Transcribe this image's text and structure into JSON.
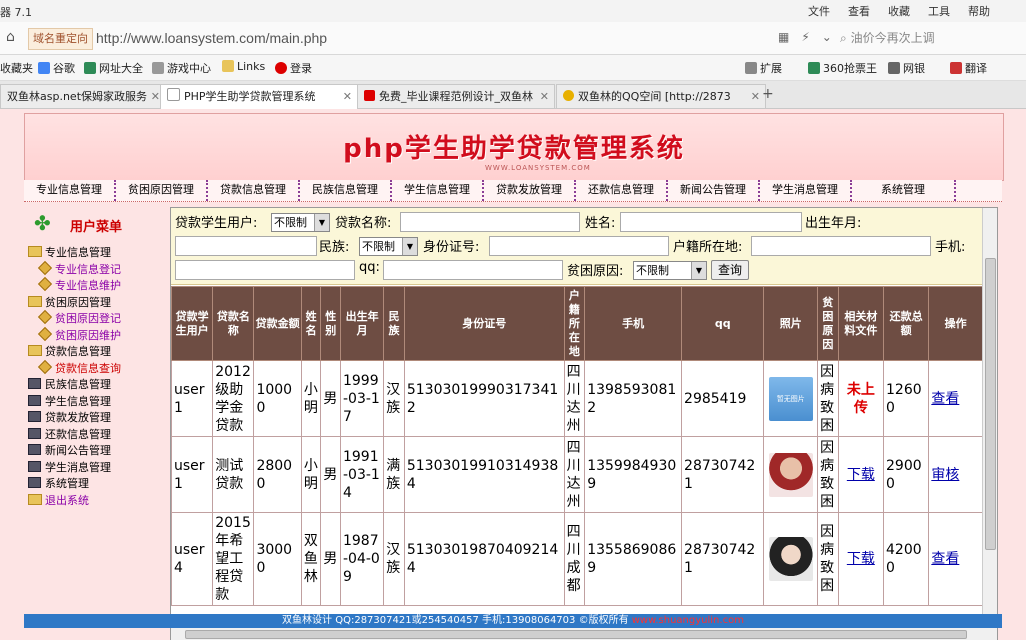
{
  "browser": {
    "app_title": "器 7.1",
    "menus": [
      "文件",
      "查看",
      "收藏",
      "工具",
      "帮助"
    ],
    "redirect_label": "域名重定向",
    "url": "http://www.loansystem.com/main.php",
    "search_placeholder": "油价今再次上调",
    "favorites": [
      {
        "label": "收藏夹",
        "color": "#f2b400"
      },
      {
        "label": "谷歌",
        "color": "#4285f4"
      },
      {
        "label": "网址大全",
        "color": "#2e8b57"
      },
      {
        "label": "游戏中心",
        "color": "#999"
      },
      {
        "label": "Links",
        "color": "#e8c45a"
      },
      {
        "label": "登录",
        "color": "#d00"
      },
      {
        "label": "扩展",
        "color": "#888"
      },
      {
        "label": "360抢票王",
        "color": "#2e8b57"
      },
      {
        "label": "网银",
        "color": "#666"
      },
      {
        "label": "翻译",
        "color": "#c33"
      }
    ],
    "tabs": [
      {
        "label": "双鱼林asp.net保姆家政服务",
        "color": "#2060c0",
        "active": false
      },
      {
        "label": "PHP学生助学贷款管理系统",
        "color": "#dddddd",
        "active": true
      },
      {
        "label": "免费_毕业课程范例设计_双鱼林",
        "color": "#d00",
        "active": false
      },
      {
        "label": "双鱼林的QQ空间 [http://2873",
        "color": "#e8b000",
        "active": false
      }
    ]
  },
  "banner": {
    "title": "php学生助学贷款管理系统",
    "subtitle": "WWW.LOANSYSTEM.COM"
  },
  "nav": [
    "专业信息管理",
    "贫困原因管理",
    "贷款信息管理",
    "民族信息管理",
    "学生信息管理",
    "贷款发放管理",
    "还款信息管理",
    "新闻公告管理",
    "学生消息管理",
    "系统管理"
  ],
  "sidebar": {
    "title": "用户菜单",
    "groups": [
      {
        "label": "专业信息管理",
        "type": "folder",
        "children": [
          {
            "label": "专业信息登记",
            "current": false
          },
          {
            "label": "专业信息维护",
            "current": false
          }
        ]
      },
      {
        "label": "贫困原因管理",
        "type": "folder",
        "children": [
          {
            "label": "贫困原因登记",
            "current": false
          },
          {
            "label": "贫困原因维护",
            "current": false
          }
        ]
      },
      {
        "label": "贷款信息管理",
        "type": "folder",
        "children": [
          {
            "label": "贷款信息查询",
            "current": true
          }
        ]
      },
      {
        "label": "民族信息管理",
        "type": "stack",
        "children": []
      },
      {
        "label": "学生信息管理",
        "type": "stack",
        "children": []
      },
      {
        "label": "贷款发放管理",
        "type": "stack",
        "children": []
      },
      {
        "label": "还款信息管理",
        "type": "stack",
        "children": []
      },
      {
        "label": "新闻公告管理",
        "type": "stack",
        "children": []
      },
      {
        "label": "学生消息管理",
        "type": "stack",
        "children": []
      },
      {
        "label": "系统管理",
        "type": "stack",
        "children": []
      },
      {
        "label": "退出系统",
        "type": "exit",
        "children": []
      }
    ]
  },
  "search": {
    "loan_user_label": "贷款学生用户:",
    "loan_user_value": "不限制",
    "loan_name_label": "贷款名称:",
    "name_label": "姓名:",
    "birth_label": "出生年月:",
    "nation_label": "民族:",
    "nation_value": "不限制",
    "idcard_label": "身份证号:",
    "origin_label": "户籍所在地:",
    "phone_label": "手机:",
    "qq_label": "qq:",
    "reason_label": "贫困原因:",
    "reason_value": "不限制",
    "query_button": "查询"
  },
  "table": {
    "headers": [
      "贷款学生用户",
      "贷款名称",
      "贷款金额",
      "姓名",
      "性别",
      "出生年月",
      "民族",
      "身份证号",
      "户籍所在地",
      "手机",
      "qq",
      "照片",
      "贫困原因",
      "相关材料文件",
      "还款总额",
      "操作"
    ],
    "rows": [
      {
        "user": "user1",
        "loan_name": "2012级助学金贷款",
        "amount": "10000",
        "name": "小明",
        "gender": "男",
        "birth": "1999-03-17",
        "nation": "汉族",
        "idcard": "513030199903173412",
        "origin": "四川达州",
        "phone": "13985930812",
        "qq": "2985419",
        "photo_color": "#4a8fd0",
        "photo_text": "暂无图片",
        "reason": "因病致困",
        "file": "未上传",
        "file_missing": true,
        "repay": "12600",
        "action": "查看"
      },
      {
        "user": "user1",
        "loan_name": "测试贷款",
        "amount": "28000",
        "name": "小明",
        "gender": "男",
        "birth": "1991-03-14",
        "nation": "满族",
        "idcard": "513030199103149384",
        "origin": "四川达州",
        "phone": "13599849309",
        "qq": "287307421",
        "photo_color": "#c04040",
        "photo_text": "",
        "reason": "因病致困",
        "file": "下载",
        "file_missing": false,
        "repay": "29000",
        "action": "审核"
      },
      {
        "user": "user4",
        "loan_name": "2015年希望工程贷款",
        "amount": "30000",
        "name": "双鱼林",
        "gender": "男",
        "birth": "1987-04-09",
        "nation": "汉族",
        "idcard": "513030198704092144",
        "origin": "四川成都",
        "phone": "13558690869",
        "qq": "287307421",
        "photo_color": "#555555",
        "photo_text": "",
        "reason": "因病致困",
        "file": "下载",
        "file_missing": false,
        "repay": "42000",
        "action": "查看"
      }
    ]
  },
  "footer": {
    "text": "双鱼林设计 QQ:287307421或254540457 手机:13908064703 ©版权所有 ",
    "site": "www.shuangyulin.com"
  }
}
